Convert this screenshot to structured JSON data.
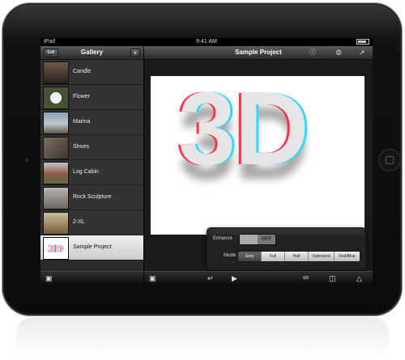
{
  "status_bar": {
    "carrier": "iPad",
    "time": "9:41 AM"
  },
  "sidebar": {
    "title": "Gallery",
    "edit_label": "Edit",
    "add_label": "+",
    "items": [
      {
        "label": "Candle"
      },
      {
        "label": "Flower"
      },
      {
        "label": "Marina"
      },
      {
        "label": "Shoes"
      },
      {
        "label": "Log Cabin"
      },
      {
        "label": "Rock Sculpture"
      },
      {
        "label": "2-XL"
      },
      {
        "label": "Sample Project",
        "selected": true
      }
    ]
  },
  "main": {
    "title": "Sample Project",
    "canvas_text": "3D"
  },
  "popover": {
    "enhance_label": "Enhance",
    "enhance_state": "OFF",
    "mode_label": "Mode",
    "modes": [
      "Grey",
      "Full",
      "Half",
      "Optimized",
      "Red/Blue"
    ],
    "active_mode": "Grey"
  },
  "icons": {
    "info": "info-icon",
    "settings": "gear-icon",
    "share": "share-icon",
    "photo": "photo-icon",
    "back": "back-icon",
    "play": "play-icon",
    "glasses": "3d-glasses-icon",
    "split": "split-view-icon",
    "crop": "crop-icon",
    "export": "export-icon"
  }
}
